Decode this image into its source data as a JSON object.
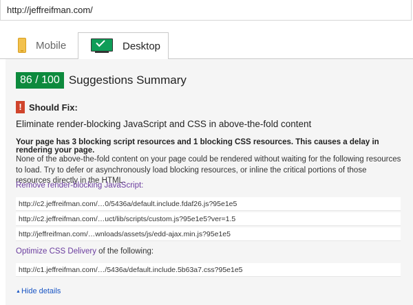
{
  "address_bar": {
    "url": "http://jeffreifman.com/"
  },
  "tabs": [
    {
      "label": "Mobile",
      "icon": "phone-icon",
      "active": false
    },
    {
      "label": "Desktop",
      "icon": "monitor-check-icon",
      "active": true
    }
  ],
  "summary": {
    "score": "86 / 100",
    "score_color": "#0d8a3d",
    "title": "Suggestions Summary"
  },
  "should_fix": {
    "badge": "!",
    "badge_color": "#d0442c",
    "label": "Should Fix:"
  },
  "rule": {
    "title": "Eliminate render-blocking JavaScript and CSS in above-the-fold content",
    "summary": "Your page has 3 blocking script resources and 1 blocking CSS resources. This causes a delay in rendering your page.",
    "description": "None of the above-the-fold content on your page could be rendered without waiting for the following resources to load. Try to defer or asynchronously load blocking resources, or inline the critical portions of those resources directly in the HTML.",
    "js_link": "Remove render-blocking JavaScript:",
    "js_urls": [
      "http://c2.jeffreifman.com/…0/5436a/default.include.fdaf26.js?95e1e5",
      "http://c2.jeffreifman.com/…uct/lib/scripts/custom.js?95e1e5?ver=1.5",
      "http://jeffreifman.com/…wnloads/assets/js/edd-ajax.min.js?95e1e5"
    ],
    "css_link": "Optimize CSS Delivery",
    "css_suffix": " of the following:",
    "css_urls": [
      "http://c1.jeffreifman.com/…/5436a/default.include.5b63a7.css?95e1e5"
    ],
    "hide_details": "Hide details"
  }
}
